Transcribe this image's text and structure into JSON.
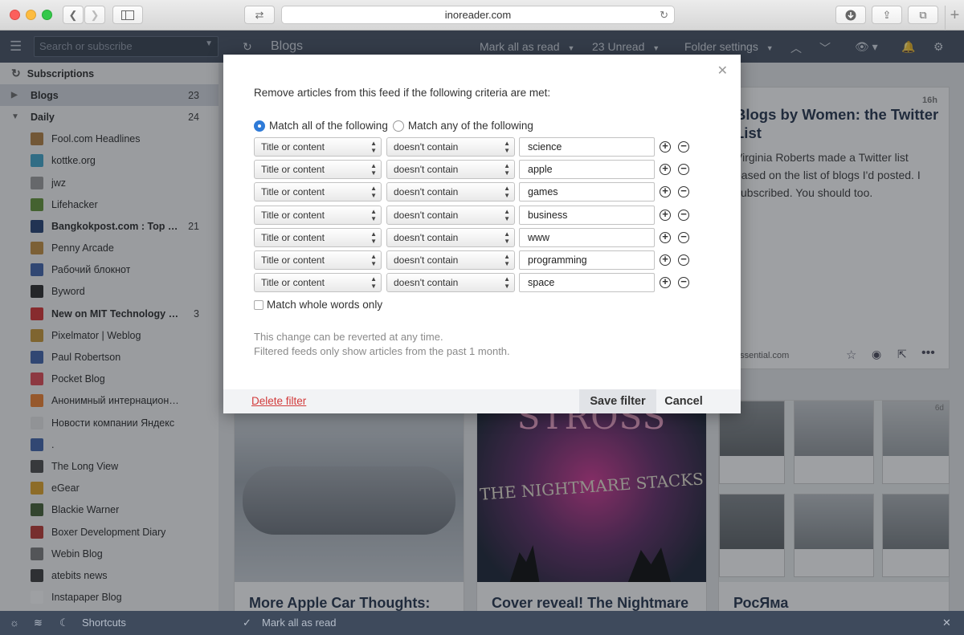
{
  "browser": {
    "url": "inoreader.com",
    "buttons": [
      "back",
      "forward",
      "sidebar",
      "tab-switch",
      "reload",
      "download",
      "share",
      "tabs",
      "new-tab"
    ]
  },
  "sidebar": {
    "search_placeholder": "Search or subscribe",
    "subscriptions_label": "Subscriptions",
    "folders": [
      {
        "label": "Blogs",
        "count": "23",
        "expanded": false
      },
      {
        "label": "Daily",
        "count": "24",
        "expanded": true
      }
    ],
    "feeds": [
      {
        "title": "Fool.com Headlines",
        "count": "",
        "bold": false,
        "icon": "fool-icon",
        "color": "#b07a3a"
      },
      {
        "title": "kottke.org",
        "count": "",
        "bold": false,
        "icon": "kottke-icon",
        "color": "#3aa3c9"
      },
      {
        "title": "jwz",
        "count": "",
        "bold": false,
        "icon": "jwz-icon",
        "color": "#999999"
      },
      {
        "title": "Lifehacker",
        "count": "",
        "bold": false,
        "icon": "lifehacker-icon",
        "color": "#5c8f2f"
      },
      {
        "title": "Bangkokpost.com : Top …",
        "count": "21",
        "bold": true,
        "icon": "bangkokpost-icon",
        "color": "#1d3a6d"
      },
      {
        "title": "Penny Arcade",
        "count": "",
        "bold": false,
        "icon": "penny-arcade-icon",
        "color": "#c28a3a"
      },
      {
        "title": "Рабочий блокнот",
        "count": "",
        "bold": false,
        "icon": "pencil-icon",
        "color": "#3a5ea8"
      },
      {
        "title": "Byword",
        "count": "",
        "bold": false,
        "icon": "byword-icon",
        "color": "#222222"
      },
      {
        "title": "New on MIT Technology …",
        "count": "3",
        "bold": true,
        "icon": "mit-icon",
        "color": "#d62b2b"
      },
      {
        "title": "Pixelmator | Weblog",
        "count": "",
        "bold": false,
        "icon": "pixelmator-icon",
        "color": "#c7942e"
      },
      {
        "title": "Paul Robertson",
        "count": "",
        "bold": false,
        "icon": "pencil-icon",
        "color": "#3a5ea8"
      },
      {
        "title": "Pocket Blog",
        "count": "",
        "bold": false,
        "icon": "pocket-icon",
        "color": "#e0424e"
      },
      {
        "title": "Анонимный интернацион…",
        "count": "",
        "bold": false,
        "icon": "blogger-icon",
        "color": "#f07d27"
      },
      {
        "title": "Новости компании Яндекс",
        "count": "",
        "bold": false,
        "icon": "yandex-icon",
        "color": "#e8e8e8"
      },
      {
        "title": ".",
        "count": "",
        "bold": false,
        "icon": "pencil-icon",
        "color": "#3a5ea8"
      },
      {
        "title": "The Long View",
        "count": "",
        "bold": false,
        "icon": "rss-icon",
        "color": "#444444"
      },
      {
        "title": "eGear",
        "count": "",
        "bold": false,
        "icon": "egear-icon",
        "color": "#e0a020"
      },
      {
        "title": "Blackie Warner",
        "count": "",
        "bold": false,
        "icon": "blackie-icon",
        "color": "#3c5a2c"
      },
      {
        "title": "Boxer Development Diary",
        "count": "",
        "bold": false,
        "icon": "boxer-icon",
        "color": "#b8302a"
      },
      {
        "title": "Webin Blog",
        "count": "",
        "bold": false,
        "icon": "webin-icon",
        "color": "#777777"
      },
      {
        "title": "atebits news",
        "count": "",
        "bold": false,
        "icon": "atebits-icon",
        "color": "#333333"
      },
      {
        "title": "Instapaper Blog",
        "count": "",
        "bold": false,
        "icon": "instapaper-icon",
        "color": "#ffffff"
      }
    ]
  },
  "topbar": {
    "title": "Blogs",
    "mark_all_read": "Mark all as read",
    "unread": "23 Unread",
    "folder_settings": "Folder settings"
  },
  "article": {
    "age": "16h",
    "title_l1": "Blogs by Women: the Twitter",
    "title_l2": "List",
    "body_l1": "Virginia Roberts made a Twitter list",
    "body_l2": "based on the list of blogs I'd posted. I",
    "body_l3": "subscribed. You should too.",
    "source": "essential.com"
  },
  "cards": [
    {
      "title": "More Apple Car Thoughts:"
    },
    {
      "title": "Cover reveal! The Nightmare",
      "cover_top": "STROSS",
      "cover_sub": "THE NIGHTMARE STACKS"
    },
    {
      "title": "РосЯма",
      "age": "6d"
    }
  ],
  "modal": {
    "intro": "Remove articles from this feed if the following criteria are met:",
    "match_all": "Match all of the following",
    "match_any": "Match any of the following",
    "field_label": "Title or content",
    "op_label": "doesn't contain",
    "criteria": [
      "science",
      "apple",
      "games",
      "business",
      "www",
      "programming",
      "space"
    ],
    "whole_words": "Match whole words only",
    "note1": "This change can be reverted at any time.",
    "note2": "Filtered feeds only show articles from the past 1 month.",
    "delete": "Delete filter",
    "save": "Save filter",
    "cancel": "Cancel"
  },
  "bottombar": {
    "shortcuts": "Shortcuts",
    "mark_all_read": "Mark all as read"
  },
  "colors": {
    "navbar": "#3e4a5c",
    "accent": "#2f7bd8",
    "delete": "#d23a3a"
  }
}
